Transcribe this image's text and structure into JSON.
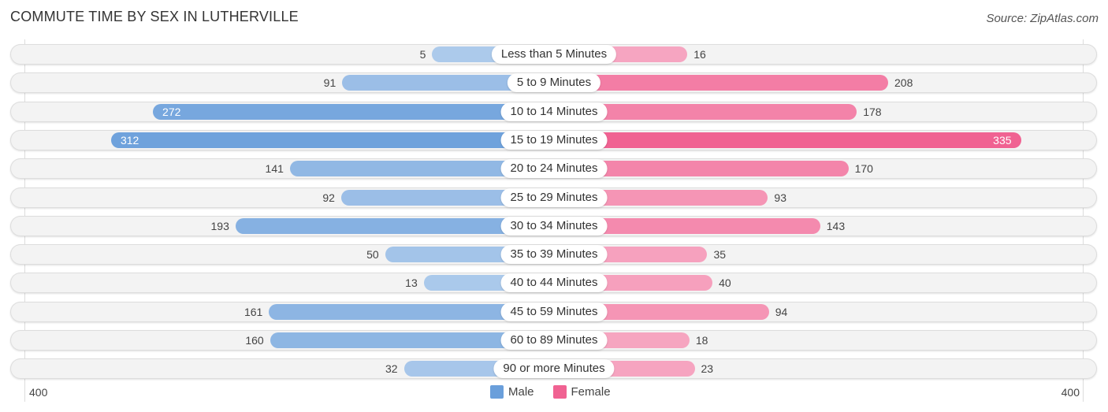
{
  "chart_data": {
    "type": "bar",
    "orientation": "horizontal-diverging",
    "title": "COMMUTE TIME BY SEX IN LUTHERVILLE",
    "source": "Source: ZipAtlas.com",
    "categories": [
      "Less than 5 Minutes",
      "5 to 9 Minutes",
      "10 to 14 Minutes",
      "15 to 19 Minutes",
      "20 to 24 Minutes",
      "25 to 29 Minutes",
      "30 to 34 Minutes",
      "35 to 39 Minutes",
      "40 to 44 Minutes",
      "45 to 59 Minutes",
      "60 to 89 Minutes",
      "90 or more Minutes"
    ],
    "series": [
      {
        "name": "Male",
        "color": "#6a9fdb",
        "values": [
          5,
          91,
          272,
          312,
          141,
          92,
          193,
          50,
          13,
          161,
          160,
          32
        ]
      },
      {
        "name": "Female",
        "color": "#f06292",
        "values": [
          16,
          208,
          178,
          335,
          170,
          93,
          143,
          35,
          40,
          94,
          18,
          23
        ]
      }
    ],
    "axis_left_label": "400",
    "axis_right_label": "400",
    "xlim": [
      -400,
      400
    ],
    "legend_position": "bottom-center"
  }
}
